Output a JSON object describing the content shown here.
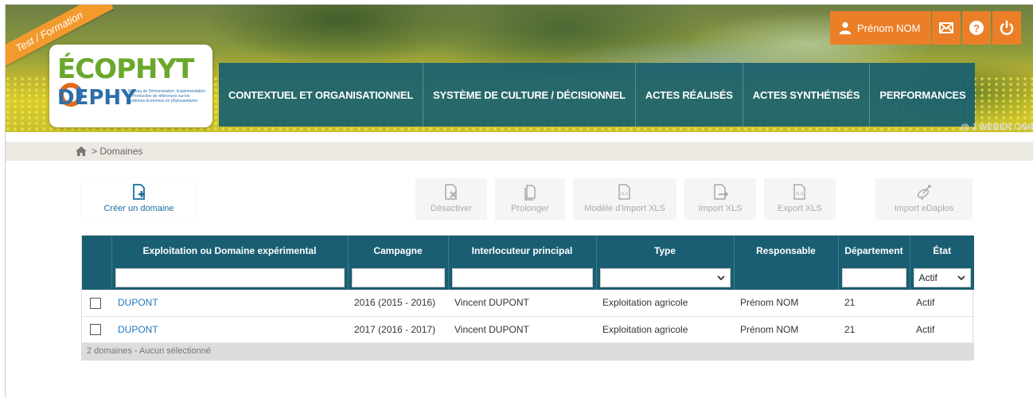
{
  "banner": {
    "ribbon": "Test / Formation",
    "logo": {
      "line1": "ÉCOPHYT",
      "line2": "DEPHY",
      "tagline": "Réseau de Démonstration, Expérimentation et Production de références sur les systèmes économes en phytosanitaires"
    },
    "nav": [
      "CONTEXTUEL ET ORGANISATIONNEL",
      "SYSTÈME DE CULTURE / DÉCISIONNEL",
      "ACTES RÉALISÉS",
      "ACTES SYNTHÉTISÉS",
      "PERFORMANCES"
    ],
    "credit": "@ J WEBER / INR",
    "user": {
      "name": "Prénom NOM"
    },
    "icons": [
      "person-icon",
      "mail-icon",
      "help-icon",
      "power-icon"
    ]
  },
  "breadcrumb": {
    "current": "> Domaines"
  },
  "toolbar": {
    "create": "Créer un domaine",
    "deactivate": "Désactiver",
    "extend": "Prolonger",
    "template": "Modèle d'import XLS",
    "import": "Import XLS",
    "export": "Export XLS",
    "edaplos": "Import eDaplos"
  },
  "table": {
    "headers": [
      "Exploitation ou Domaine expérimental",
      "Campagne",
      "Interlocuteur principal",
      "Type",
      "Responsable",
      "Département",
      "État"
    ],
    "state_filter": "Actif",
    "rows": [
      {
        "name": "DUPONT",
        "campaign": "2016 (2015 - 2016)",
        "contact": "Vincent DUPONT",
        "type": "Exploitation agricole",
        "owner": "Prénom NOM",
        "dept": "21",
        "state": "Actif"
      },
      {
        "name": "DUPONT",
        "campaign": "2017 (2016 - 2017)",
        "contact": "Vincent DUPONT",
        "type": "Exploitation agricole",
        "owner": "Prénom NOM",
        "dept": "21",
        "state": "Actif"
      }
    ],
    "footer": "2 domaines - Aucun sélectionné"
  },
  "colors": {
    "nav": "#1a6272",
    "accent": "#ea7f28",
    "link": "#1f78c1",
    "header": "#1a5e73"
  }
}
